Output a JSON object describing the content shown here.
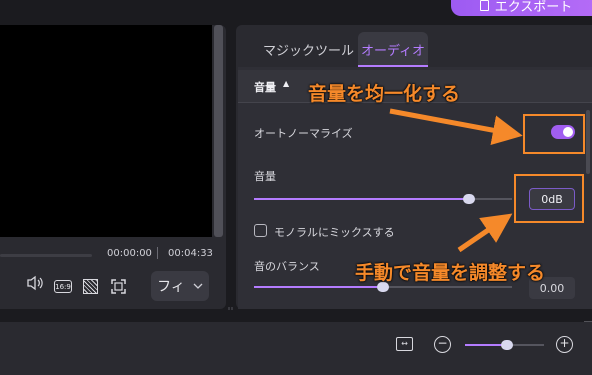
{
  "header": {
    "export_label": "エクスポート"
  },
  "player": {
    "time_current": "00:00:00",
    "time_total": "00:04:33",
    "fit_select_value": "フィ",
    "ratio_icon_label": "16:9"
  },
  "panel": {
    "tabs": [
      {
        "label": "マジックツール",
        "active": false
      },
      {
        "label": "オーディオ",
        "active": true
      }
    ],
    "section_title": "音量",
    "normalize_label": "オートノーマライズ",
    "normalize_on": true,
    "volume_label": "音量",
    "volume_value": "0dB",
    "volume_level": 0.83,
    "mono_label": "モノラルにミックスする",
    "mono_checked": false,
    "balance_label": "音のバランス",
    "balance_value": "0.00",
    "balance_level": 0.5
  },
  "timeline": {
    "zoom_level": 0.55
  },
  "annotations": {
    "normalize": "音量を均一化する",
    "manual": "手動で音量を調整する",
    "color": "#f5892a"
  },
  "colors": {
    "accent": "#b47cff",
    "toggle": "#a15ef0",
    "export_gradient_start": "#9d5bf2"
  }
}
